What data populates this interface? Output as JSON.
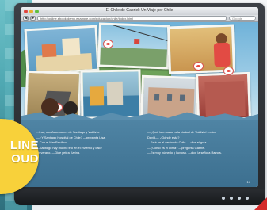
{
  "browser": {
    "title": "El Chile de Gabriel: Un Viaje por Chile",
    "url": "http://online.ebook-demo.example.com/educacion/chile/index.html",
    "search_placeholder": "Google",
    "back_label": "◀",
    "forward_label": "▶"
  },
  "book": {
    "left_lines": [
      "...tras, son Ascensores de Santiago y Valdivia.",
      "—¿Y Santiago Hospital de Chile? —pregunta Lisa.",
      "—Con el Mar Pacífico.",
      "—Santiago hay mucho frío en el invierno y calor",
      "en verano. —Dice pelea Karina."
    ],
    "right_lines": [
      "—¿Qué hermosas es la ciudad de Valdivia! —dice",
      "David—. ¿Dónde está?",
      "—Está en el centro de Chile. —dice el guía.",
      "—¿Cómo es el clima? —pregunta Gabriel.",
      "—Es muy húmedo y lluvioso. —dice la señora Ramos."
    ],
    "page_number": "13"
  },
  "badge": {
    "line1": "LINE",
    "line2": "OUD"
  },
  "colors": {
    "badge": "#f8d13a",
    "page": "#4f84a4",
    "bezel": "#2b2e33"
  }
}
